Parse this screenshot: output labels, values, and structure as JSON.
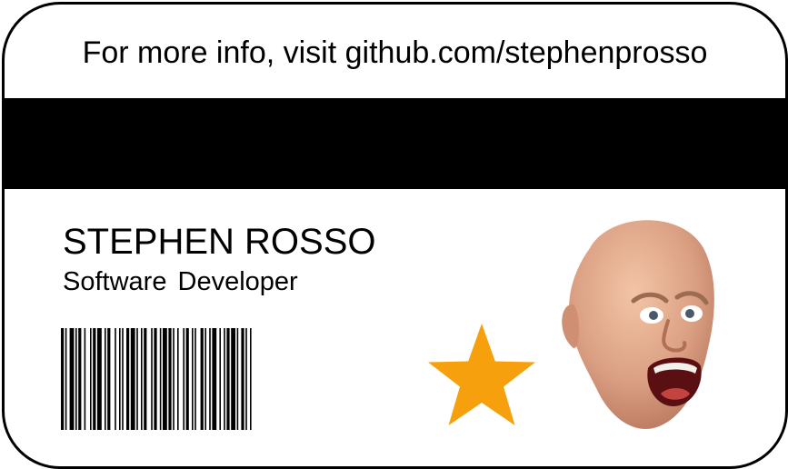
{
  "card": {
    "info_text": "For more info, visit github.com/stephenprosso",
    "name": "STEPHEN ROSSO",
    "title": "Software Developer"
  },
  "icons": {
    "star": "star-icon",
    "barcode": "barcode-icon",
    "avatar": "face-photo"
  },
  "colors": {
    "border": "#000000",
    "stripe": "#000000",
    "star": "#F5A00C",
    "background": "#ffffff"
  }
}
